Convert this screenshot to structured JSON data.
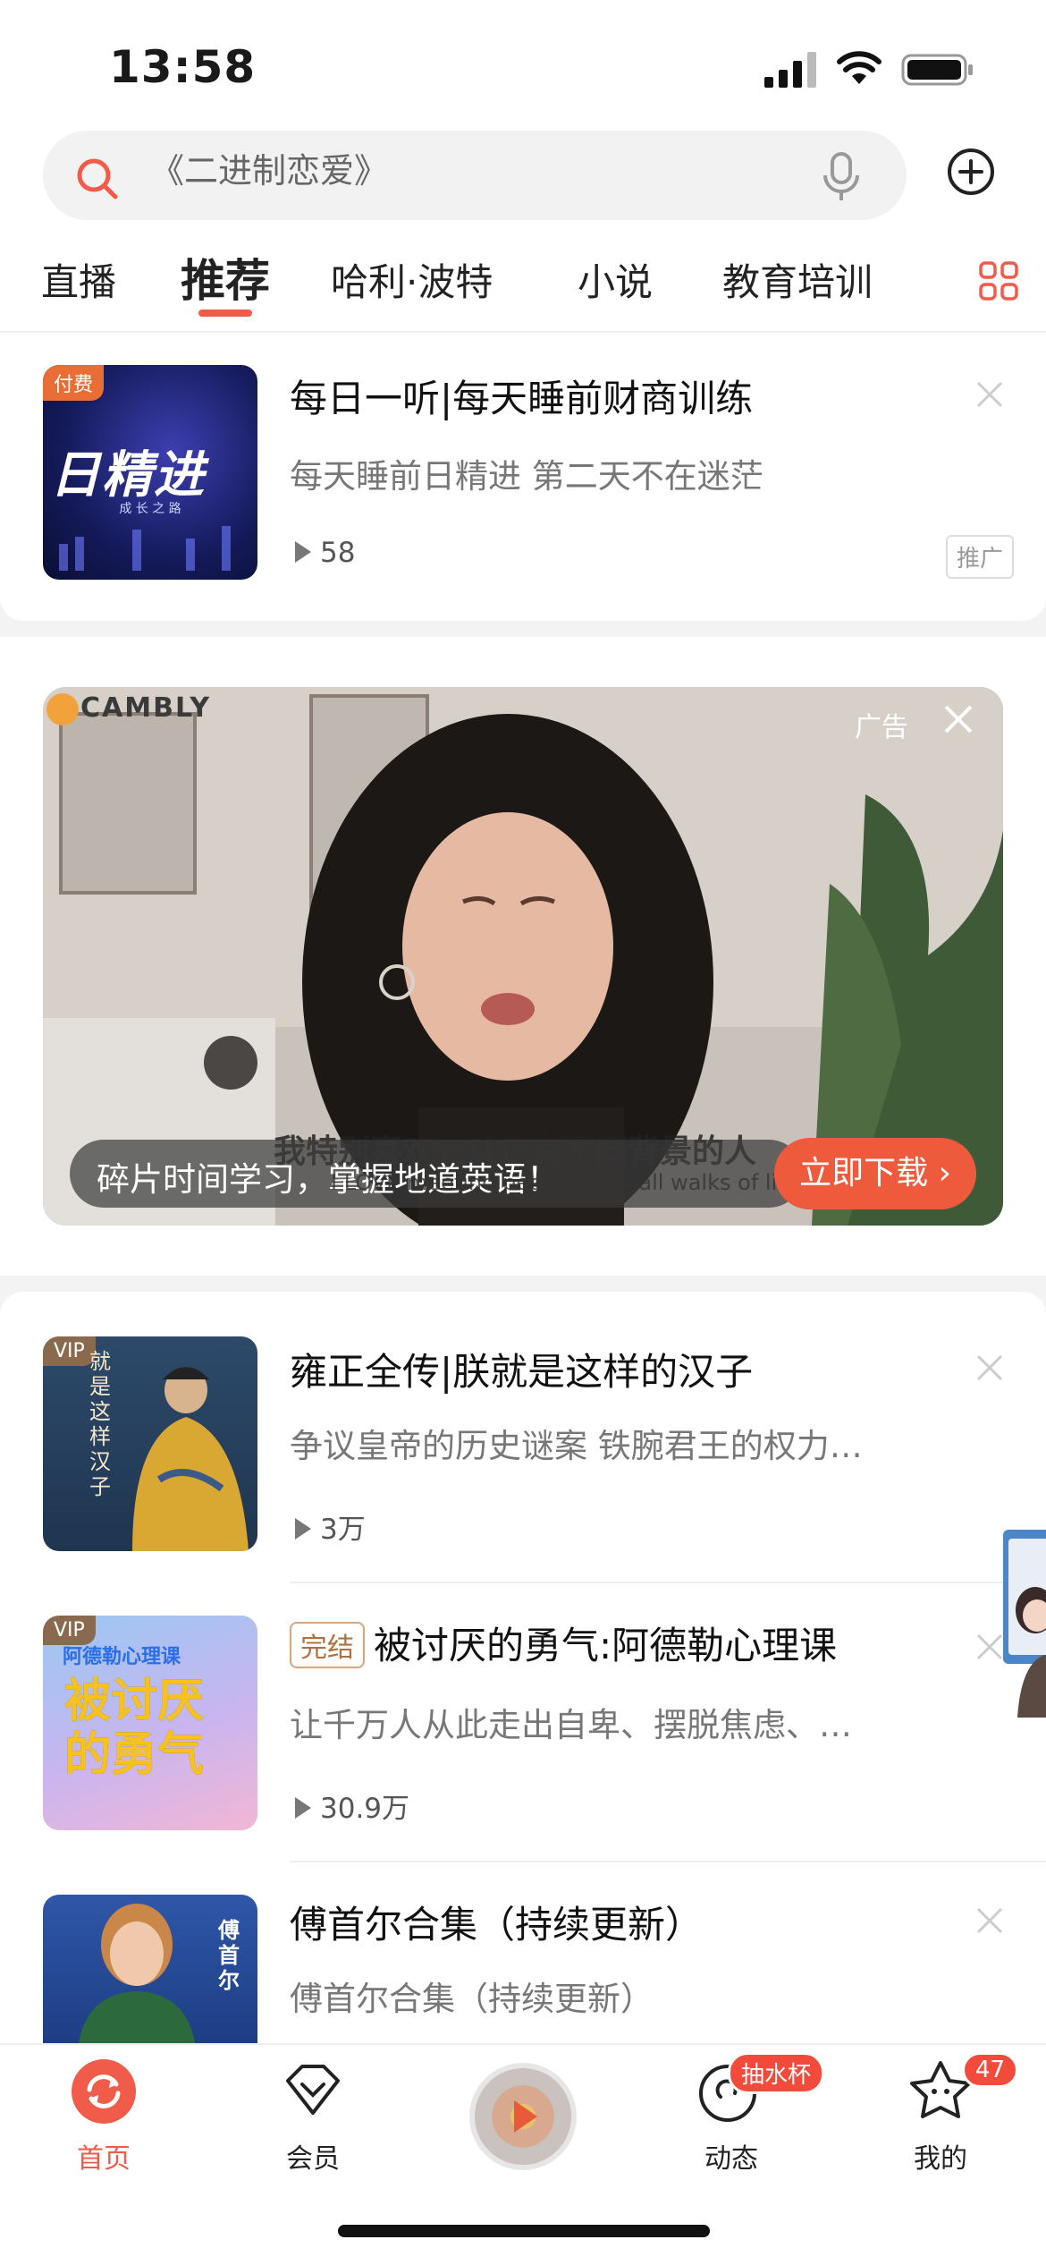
{
  "status": {
    "time": "13:58"
  },
  "search": {
    "placeholder": "《二进制恋爱》"
  },
  "tabs": [
    {
      "label": "直播"
    },
    {
      "label": "推荐"
    },
    {
      "label": "哈利·波特"
    },
    {
      "label": "小说"
    },
    {
      "label": "教育培训"
    }
  ],
  "items": [
    {
      "title": "每日一听|每天睡前财商训练",
      "desc": "每天睡前日精进 第二天不在迷茫",
      "plays": "58",
      "badge": "付费",
      "cover_text": "日精进",
      "cover_sub": "成 长 之 路",
      "promo": "推广"
    },
    {
      "title": "雍正全传|朕就是这样的汉子",
      "desc": "争议皇帝的历史谜案 铁腕君王的权力…",
      "plays": "3万",
      "badge": "VIP",
      "cover_text": "就是这样汉子"
    },
    {
      "tag": "完结",
      "title": "被讨厌的勇气:阿德勒心理课",
      "desc": "让千万人从此走出自卑、摆脱焦虑、…",
      "plays": "30.9万",
      "badge": "VIP",
      "cover_text": "被讨厌的勇气",
      "cover_sub": "阿德勒心理课"
    },
    {
      "title": "傅首尔合集（持续更新）",
      "desc": "傅首尔合集（持续更新）",
      "cover_text": "傅首尔"
    }
  ],
  "ad": {
    "brand": "CAMBLY",
    "label": "广告",
    "caption": "碎片时间学习，掌握地道英语！",
    "cta": "立即下载 ›",
    "subtitle_zh": "我特别喜欢去认识有不同背景的人",
    "subtitle_en": "I LOVE meeting people from all walks of life"
  },
  "tabbar": {
    "items": [
      {
        "label": "首页"
      },
      {
        "label": "会员"
      },
      {
        "label": ""
      },
      {
        "label": "动态",
        "badge": "抽水杯"
      },
      {
        "label": "我的",
        "badge": "47"
      }
    ]
  },
  "colors": {
    "accent": "#f15b49",
    "cta": "#ee5a3c"
  }
}
